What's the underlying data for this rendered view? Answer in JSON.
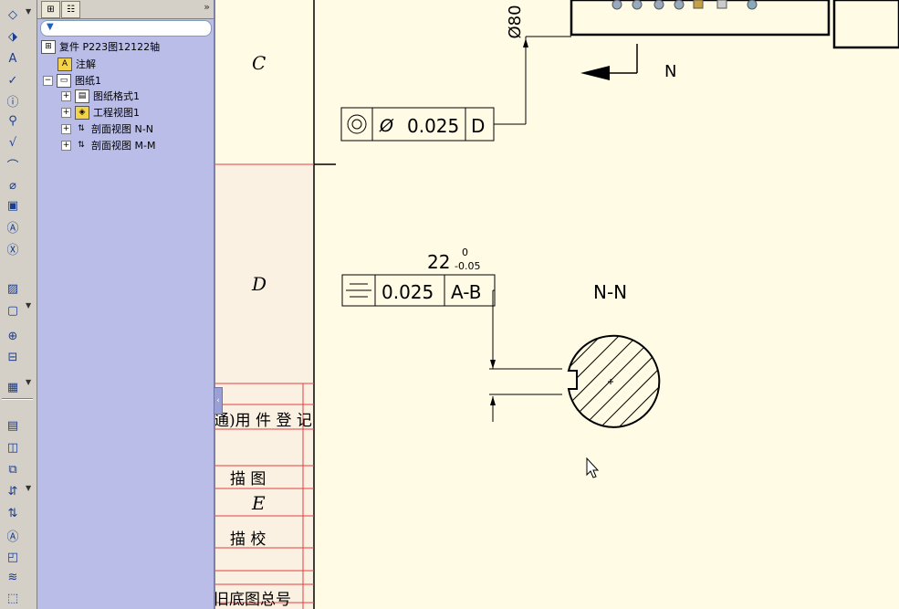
{
  "toolbar": {
    "icons": [
      "smart-dimension-icon",
      "model-items-icon",
      "note-icon",
      "spell-checker-icon",
      "balloon-icon",
      "auto-balloon-icon",
      "surface-finish-icon",
      "weld-symbol-icon",
      "hole-callout-icon",
      "geometric-tolerance-icon",
      "datum-feature-icon",
      "datum-target-icon",
      "hatch-fill-icon",
      "block-icon",
      "center-mark-icon",
      "centerline-icon",
      "table-icon",
      "view-palette-icon",
      "model-view-icon",
      "projected-view-icon",
      "auxiliary-view-icon",
      "section-view-icon",
      "detail-view-icon",
      "standard-3-view-icon",
      "break-view-icon",
      "crop-view-icon"
    ]
  },
  "tree": {
    "tabs": [
      "feature-manager-tab",
      "property-manager-tab"
    ],
    "more": "»",
    "filter_placeholder": "",
    "root": "复件 P223图12122轴",
    "annotations": "注解",
    "sheet": "图纸1",
    "children": [
      "图纸格式1",
      "工程视图1",
      "剖面视图 N-N",
      "剖面视图 M-M"
    ]
  },
  "drawing": {
    "zone_c": "C",
    "zone_d": "D",
    "zone_e": "E",
    "title_block": {
      "row1": "通)用 件 登 记",
      "row2": "描  图",
      "row3": "描  校",
      "row4": "旧底图总号"
    },
    "dim_diameter": "Ø80",
    "section_label_n": "N",
    "gtol1": {
      "symbol": "◎",
      "dia": "Ø",
      "value": "0.025",
      "datum": "D"
    },
    "dim22": {
      "nominal": "22",
      "upper": "0",
      "lower": "-0.05"
    },
    "gtol2": {
      "symbol": "⌯",
      "value": "0.025",
      "datum": "A-B"
    },
    "section_title": "N-N"
  }
}
